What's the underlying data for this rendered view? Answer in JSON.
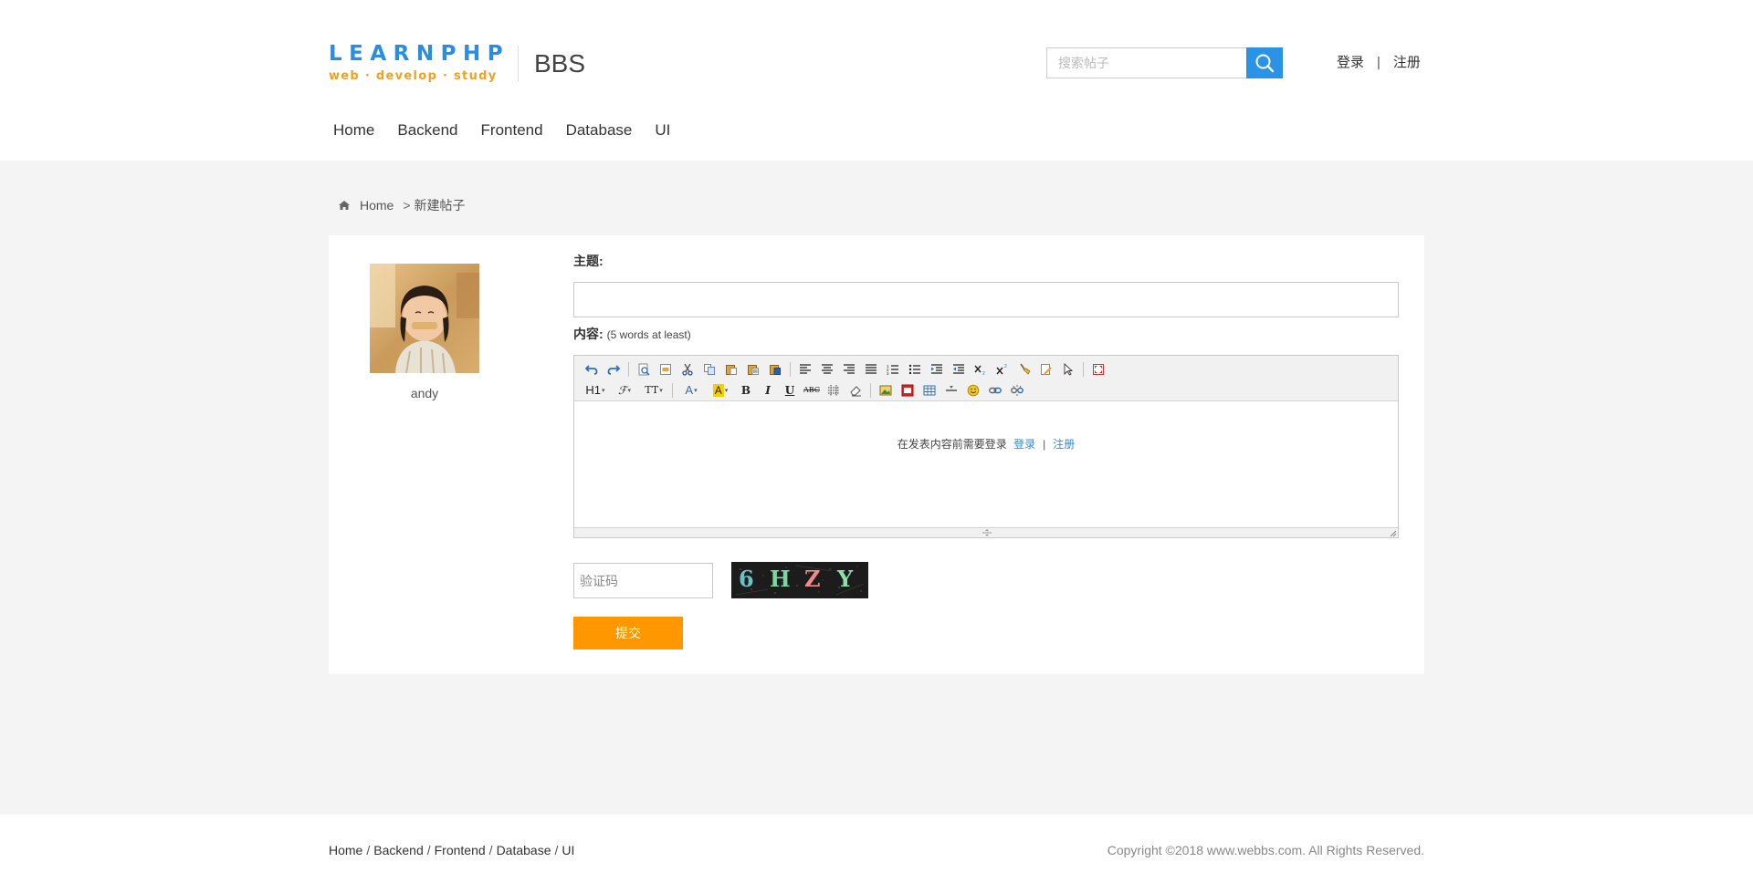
{
  "header": {
    "logo_main": "LEARNPHP",
    "logo_sub": "web · develop · study",
    "site_name": "BBS",
    "search": {
      "placeholder": "搜索帖子",
      "value": ""
    },
    "auth": {
      "login": "登录",
      "separator": "|",
      "register": "注册"
    }
  },
  "nav": {
    "items": [
      {
        "label": "Home"
      },
      {
        "label": "Backend"
      },
      {
        "label": "Frontend"
      },
      {
        "label": "Database"
      },
      {
        "label": "UI"
      }
    ]
  },
  "breadcrumb": {
    "home": "Home",
    "separator": ">",
    "current": "新建帖子"
  },
  "author": {
    "username": "andy"
  },
  "form": {
    "subject_label": "主题:",
    "subject_value": "",
    "content_label": "内容:",
    "content_hint": "(5 words at least)",
    "editor": {
      "heading_btn": "H1",
      "font_btn": "ℱ",
      "size_btn": "TT",
      "color_btn": "A",
      "bold_btn": "B",
      "italic_btn": "I",
      "underline_btn": "U",
      "strike_btn": "ABC",
      "login_tip": "在发表内容前需要登录",
      "login_link": "登录",
      "separator": "|",
      "register_link": "注册"
    },
    "captcha_placeholder": "验证码",
    "captcha_chars": [
      "6",
      "H",
      "Z",
      "Y"
    ],
    "submit_label": "提交"
  },
  "footer": {
    "links": [
      {
        "label": "Home"
      },
      {
        "label": "Backend"
      },
      {
        "label": "Frontend"
      },
      {
        "label": "Database"
      },
      {
        "label": "UI"
      }
    ],
    "link_separator": "/",
    "copyright": "Copyright ©2018 www.webbs.com. All Rights Reserved."
  },
  "colors": {
    "brand_blue": "#2b8de0",
    "brand_orange": "#f0a21f",
    "submit_orange": "#ff9800",
    "page_bg": "#f4f4f4"
  }
}
